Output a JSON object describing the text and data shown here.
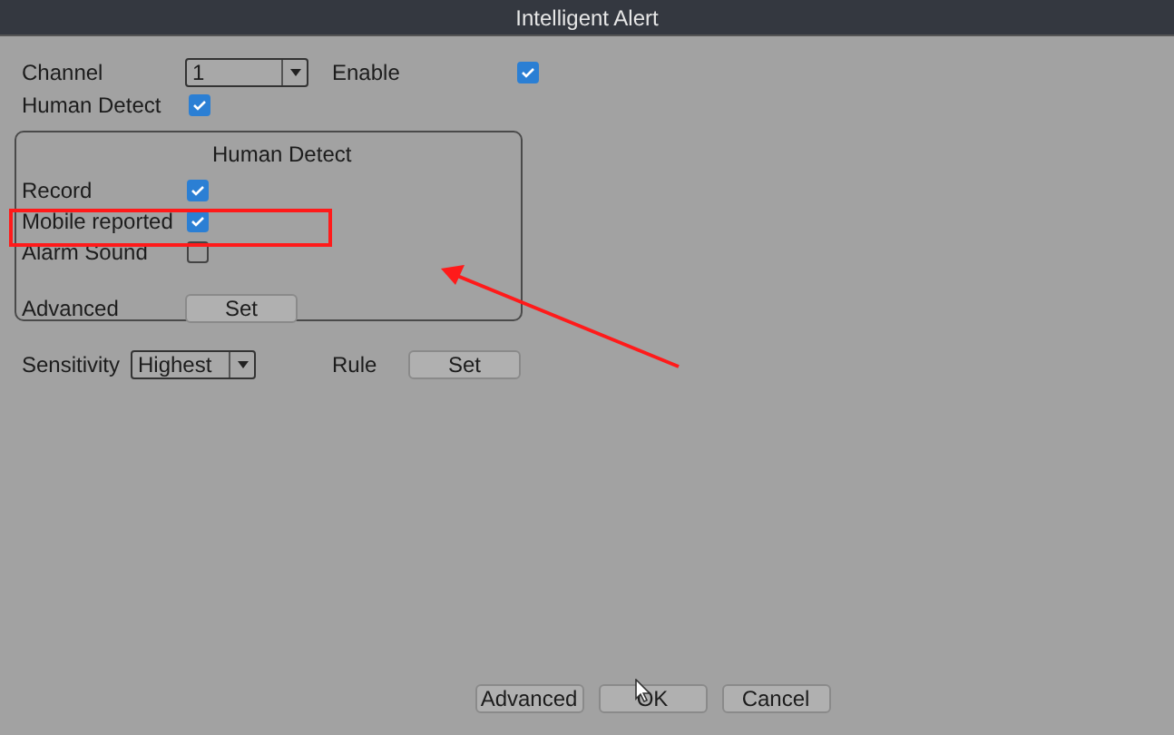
{
  "window": {
    "title": "Intelligent Alert"
  },
  "channel": {
    "label": "Channel",
    "value": "1"
  },
  "enable": {
    "label": "Enable",
    "checked": true
  },
  "human_detect": {
    "label": "Human Detect",
    "checked": true
  },
  "group": {
    "heading": "Human Detect",
    "rows": [
      {
        "label": "Record",
        "checked": true
      },
      {
        "label": "Mobile reported",
        "checked": true
      },
      {
        "label": "Alarm Sound",
        "checked": false
      }
    ],
    "advanced": {
      "label": "Advanced",
      "button": "Set"
    }
  },
  "sensitivity": {
    "label": "Sensitivity",
    "value": "Highest"
  },
  "rule": {
    "label": "Rule",
    "button": "Set"
  },
  "buttons": [
    "Advanced",
    "OK",
    "Cancel"
  ]
}
